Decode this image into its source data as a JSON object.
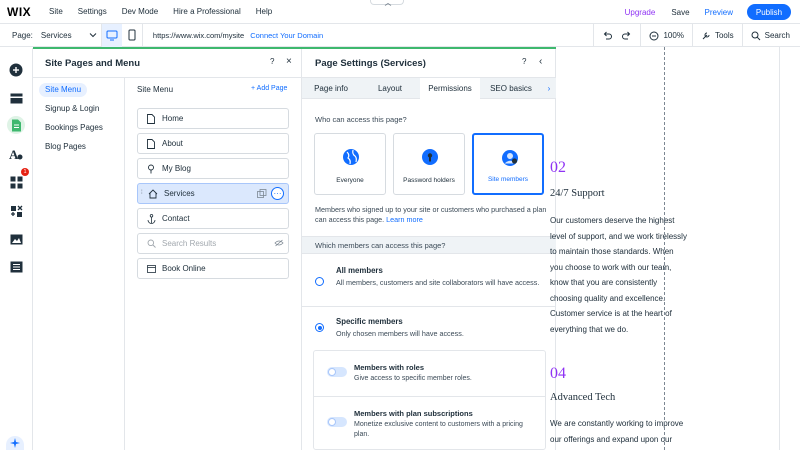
{
  "topbar": {
    "logo": "WIX",
    "menu": [
      "Site",
      "Settings",
      "Dev Mode",
      "Hire a Professional",
      "Help"
    ],
    "upgrade": "Upgrade",
    "save": "Save",
    "preview": "Preview",
    "publish": "Publish"
  },
  "bar2": {
    "page_label": "Page:",
    "page_value": "Services",
    "url": "https://www.wix.com/mysite",
    "connect": "Connect Your Domain",
    "zoom": "100%",
    "tools": "Tools",
    "search": "Search"
  },
  "rail": {
    "badge_count": "1"
  },
  "pages_panel": {
    "title": "Site Pages and Menu",
    "nav": [
      "Site Menu",
      "Signup & Login",
      "Bookings Pages",
      "Blog Pages"
    ],
    "menu_head": "Site Menu",
    "add_page": "+ Add Page",
    "items": [
      "Home",
      "About",
      "My Blog",
      "Services",
      "Contact",
      "Search Results",
      "Book Online"
    ]
  },
  "settings": {
    "title": "Page Settings (Services)",
    "tabs": [
      "Page info",
      "Layout",
      "Permissions",
      "SEO basics"
    ],
    "who_label": "Who can access this page?",
    "cards": [
      "Everyone",
      "Password holders",
      "Site members"
    ],
    "desc": "Members who signed up to your site or customers who purchased a plan can access this page.",
    "learn_more": "Learn more",
    "which_label": "Which members can access this page?",
    "all_members_title": "All members",
    "all_members_desc": "All members, customers and site collaborators will have access.",
    "specific_title": "Specific members",
    "specific_desc": "Only chosen members will have access.",
    "roles_title": "Members with roles",
    "roles_desc": "Give access to specific member roles.",
    "plans_title": "Members with plan subscriptions",
    "plans_desc": "Monetize exclusive content to customers with a pricing plan."
  },
  "canvas": {
    "num1": "02",
    "heading1": "24/7 Support",
    "para1": "Our customers deserve the highest\nlevel of support, and we work tirelessly\nto maintain those standards. When\nyou choose to work with our team,\nknow that you are consistently\nchoosing quality and excellence.\nCustomer service is at the heart of\neverything that we do.",
    "num2": "04",
    "heading2": "Advanced Tech",
    "para2": "We are constantly working to improve\nour offerings and expand upon our"
  },
  "colors": {
    "accent": "#116dff",
    "upgrade": "#8f33f4",
    "panel_topline": "#3eb86e",
    "selected_bg": "#dbe8fd"
  }
}
